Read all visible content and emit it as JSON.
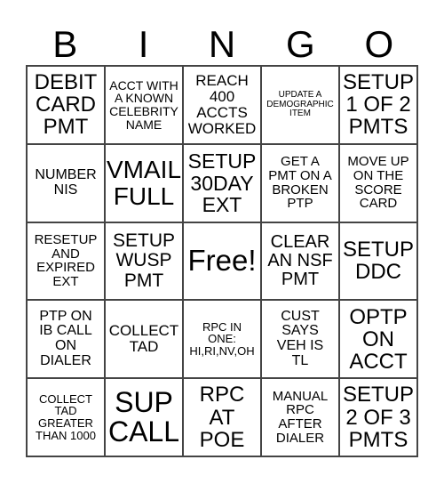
{
  "header": [
    "B",
    "I",
    "N",
    "G",
    "O"
  ],
  "cells": [
    {
      "text": "DEBIT\nCARD\nPMT",
      "size": 24
    },
    {
      "text": "ACCT WITH\nA KNOWN\nCELEBRITY\nNAME",
      "size": 14
    },
    {
      "text": "REACH\n400\nACCTS\nWORKED",
      "size": 17
    },
    {
      "text": "UPDATE A\nDEMOGRAPHIC\nITEM",
      "size": 10
    },
    {
      "text": "SETUP\n1 OF 2\nPMTS",
      "size": 24
    },
    {
      "text": "NUMBER\nNIS",
      "size": 16
    },
    {
      "text": "VMAIL\nFULL",
      "size": 28
    },
    {
      "text": "SETUP\n30DAY\nEXT",
      "size": 23
    },
    {
      "text": "GET A\nPMT ON A\nBROKEN\nPTP",
      "size": 15
    },
    {
      "text": "MOVE UP\nON THE\nSCORE\nCARD",
      "size": 15
    },
    {
      "text": "RESETUP\nAND\nEXPIRED\nEXT",
      "size": 15
    },
    {
      "text": "SETUP\nWUSP\nPMT",
      "size": 21
    },
    {
      "text": "Free!",
      "size": 33
    },
    {
      "text": "CLEAR\nAN NSF\nPMT",
      "size": 20
    },
    {
      "text": "SETUP\nDDC",
      "size": 24
    },
    {
      "text": "PTP ON\nIB CALL\nON\nDIALER",
      "size": 16
    },
    {
      "text": "COLLECT\nTAD",
      "size": 17
    },
    {
      "text": "RPC IN\nONE:\nHI,RI,NV,OH",
      "size": 13
    },
    {
      "text": "CUST\nSAYS\nVEH IS\nTL",
      "size": 16
    },
    {
      "text": "OPTP\nON\nACCT",
      "size": 24
    },
    {
      "text": "COLLECT\nTAD\nGREATER\nTHAN 1000",
      "size": 13
    },
    {
      "text": "SUP\nCALL",
      "size": 32
    },
    {
      "text": "RPC\nAT\nPOE",
      "size": 24
    },
    {
      "text": "MANUAL\nRPC\nAFTER\nDIALER",
      "size": 15
    },
    {
      "text": "SETUP\n2 OF 3\nPMTS",
      "size": 24
    }
  ]
}
